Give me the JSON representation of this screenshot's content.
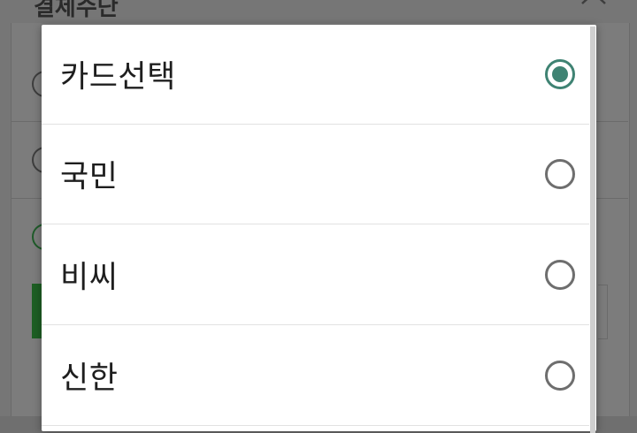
{
  "background": {
    "title": "결제수단",
    "close_icon": "close-icon"
  },
  "dialog": {
    "options": [
      {
        "label": "카드선택",
        "selected": true
      },
      {
        "label": "국민",
        "selected": false
      },
      {
        "label": "비씨",
        "selected": false
      },
      {
        "label": "신한",
        "selected": false
      }
    ],
    "accent_color": "#3f8373"
  }
}
